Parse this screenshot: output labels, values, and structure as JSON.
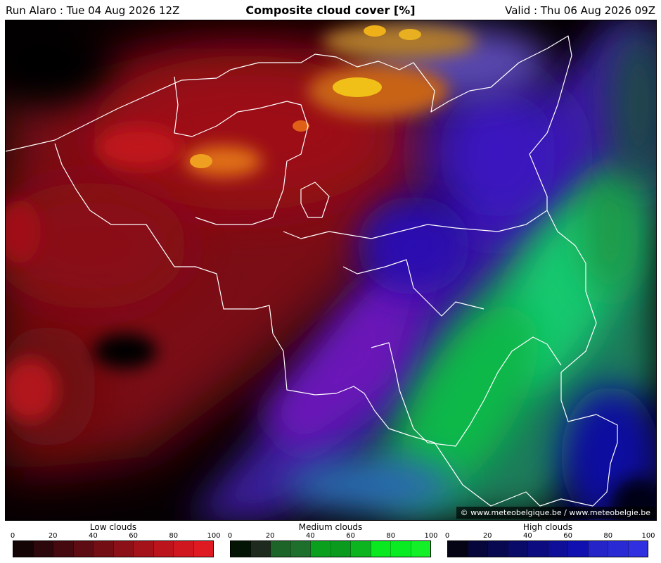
{
  "header": {
    "run": "Run Alaro : Tue 04 Aug 2026 12Z",
    "title": "Composite cloud cover [%]",
    "valid": "Valid : Thu 06 Aug 2026 09Z"
  },
  "copyright": "© www.meteobelgique.be / www.meteobelgie.be",
  "colors": {
    "background_clear": "#000000",
    "low_cloud": "#c8141e",
    "medium_cloud": "#00d060",
    "high_cloud": "#1e1ed0",
    "border_line": "#ffffff"
  },
  "legends": [
    {
      "title": "Low clouds",
      "ticks": [
        "0",
        "20",
        "40",
        "60",
        "80",
        "100"
      ],
      "colors": [
        "#140406",
        "#2c070b",
        "#440a0f",
        "#5c0c12",
        "#740e15",
        "#8c1017",
        "#a4121a",
        "#bc141c",
        "#d0161e",
        "#e01a22"
      ]
    },
    {
      "title": "Medium clouds",
      "ticks": [
        "0",
        "20",
        "40",
        "60",
        "80",
        "100"
      ],
      "colors": [
        "#041404",
        "#1e2a1e",
        "#1c6428",
        "#1e6e2c",
        "#0aa01e",
        "#0a9a1e",
        "#0cb420",
        "#0ae820",
        "#0aec22",
        "#14f028"
      ]
    },
    {
      "title": "High clouds",
      "ticks": [
        "0",
        "20",
        "40",
        "60",
        "80",
        "100"
      ],
      "colors": [
        "#040414",
        "#06063a",
        "#080850",
        "#0a0a68",
        "#0c0c80",
        "#0e0e98",
        "#1010b0",
        "#2424c8",
        "#2a2ad4",
        "#3030e0"
      ]
    }
  ]
}
